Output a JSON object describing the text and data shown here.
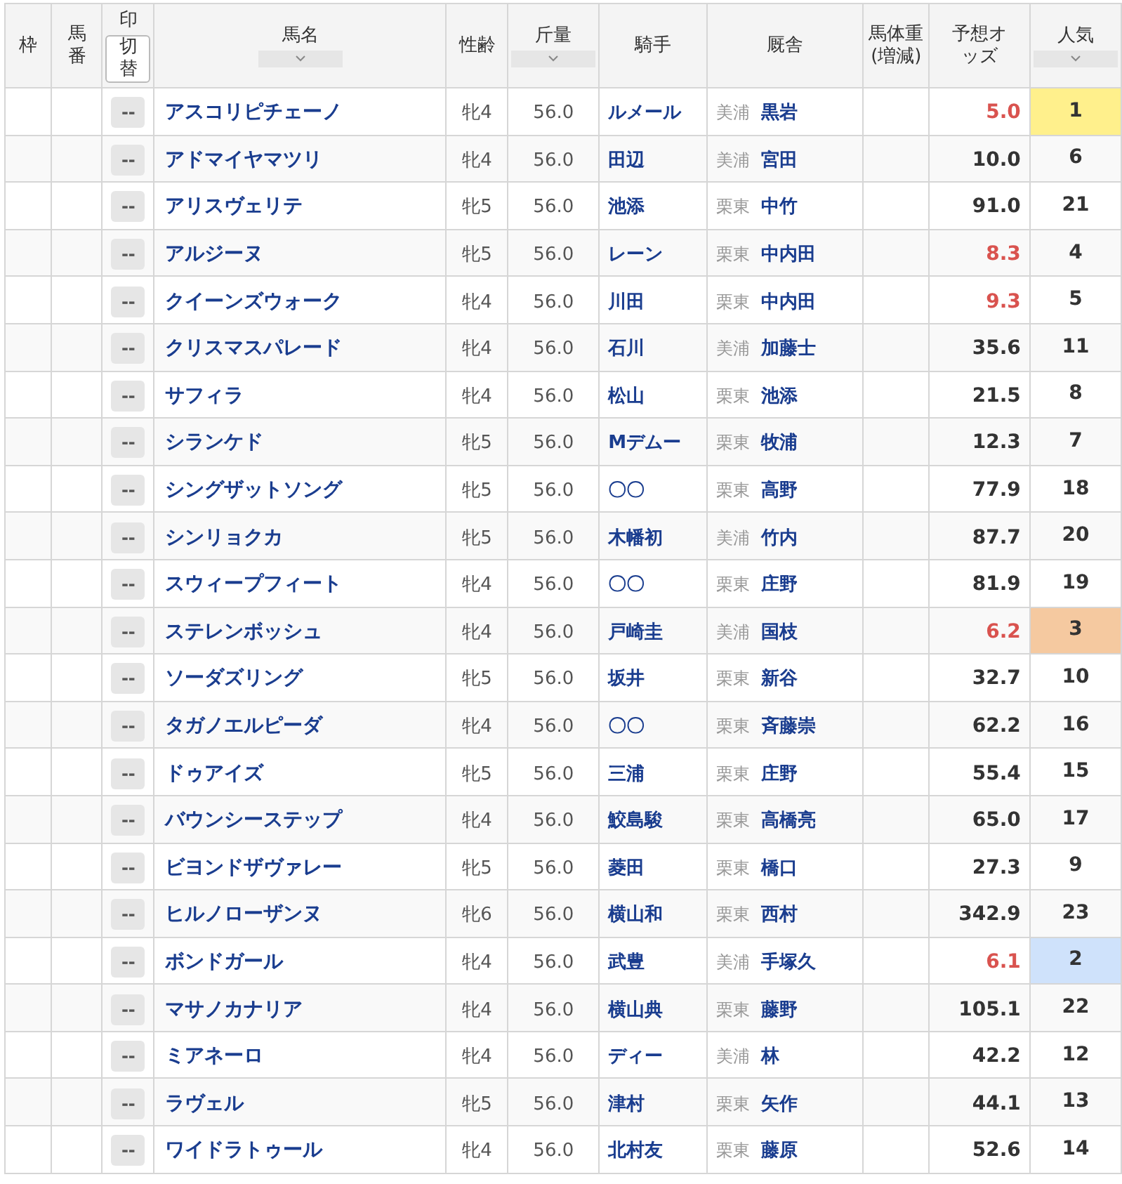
{
  "columns": [
    {
      "label": "枠",
      "sortable": false
    },
    {
      "label": "馬番",
      "sortable": false
    },
    {
      "label": "印",
      "sortable": false,
      "button": "切替"
    },
    {
      "label": "馬名",
      "sortable": true
    },
    {
      "label": "性齢",
      "sortable": false
    },
    {
      "label": "斤量",
      "sortable": true
    },
    {
      "label": "騎手",
      "sortable": false
    },
    {
      "label": "厩舎",
      "sortable": false
    },
    {
      "label": "馬体重(増減)",
      "sortable": false
    },
    {
      "label": "予想オッズ",
      "sortable": false
    },
    {
      "label": "人気",
      "sortable": true
    }
  ],
  "rows": [
    {
      "mark": "--",
      "name": "アスコリピチェーノ",
      "sex_age": "牝4",
      "weight": "56.0",
      "jockey": "ルメール",
      "region": "美浦",
      "trainer": "黒岩",
      "odds": "5.0",
      "odds_hot": true,
      "popularity": "1",
      "color": "#fff08c"
    },
    {
      "mark": "--",
      "name": "アドマイヤマツリ",
      "sex_age": "牝4",
      "weight": "56.0",
      "jockey": "田辺",
      "region": "美浦",
      "trainer": "宮田",
      "odds": "10.0",
      "odds_hot": false,
      "popularity": "6"
    },
    {
      "mark": "--",
      "name": "アリスヴェリテ",
      "sex_age": "牝5",
      "weight": "56.0",
      "jockey": "池添",
      "region": "栗東",
      "trainer": "中竹",
      "odds": "91.0",
      "odds_hot": false,
      "popularity": "21"
    },
    {
      "mark": "--",
      "name": "アルジーヌ",
      "sex_age": "牝5",
      "weight": "56.0",
      "jockey": "レーン",
      "region": "栗東",
      "trainer": "中内田",
      "odds": "8.3",
      "odds_hot": true,
      "popularity": "4"
    },
    {
      "mark": "--",
      "name": "クイーンズウォーク",
      "sex_age": "牝4",
      "weight": "56.0",
      "jockey": "川田",
      "region": "栗東",
      "trainer": "中内田",
      "odds": "9.3",
      "odds_hot": true,
      "popularity": "5"
    },
    {
      "mark": "--",
      "name": "クリスマスパレード",
      "sex_age": "牝4",
      "weight": "56.0",
      "jockey": "石川",
      "region": "美浦",
      "trainer": "加藤士",
      "odds": "35.6",
      "odds_hot": false,
      "popularity": "11"
    },
    {
      "mark": "--",
      "name": "サフィラ",
      "sex_age": "牝4",
      "weight": "56.0",
      "jockey": "松山",
      "region": "栗東",
      "trainer": "池添",
      "odds": "21.5",
      "odds_hot": false,
      "popularity": "8"
    },
    {
      "mark": "--",
      "name": "シランケド",
      "sex_age": "牝5",
      "weight": "56.0",
      "jockey": "Mデムー",
      "region": "栗東",
      "trainer": "牧浦",
      "odds": "12.3",
      "odds_hot": false,
      "popularity": "7"
    },
    {
      "mark": "--",
      "name": "シングザットソング",
      "sex_age": "牝5",
      "weight": "56.0",
      "jockey": "〇〇",
      "region": "栗東",
      "trainer": "高野",
      "odds": "77.9",
      "odds_hot": false,
      "popularity": "18"
    },
    {
      "mark": "--",
      "name": "シンリョクカ",
      "sex_age": "牝5",
      "weight": "56.0",
      "jockey": "木幡初",
      "region": "美浦",
      "trainer": "竹内",
      "odds": "87.7",
      "odds_hot": false,
      "popularity": "20"
    },
    {
      "mark": "--",
      "name": "スウィープフィート",
      "sex_age": "牝4",
      "weight": "56.0",
      "jockey": "〇〇",
      "region": "栗東",
      "trainer": "庄野",
      "odds": "81.9",
      "odds_hot": false,
      "popularity": "19"
    },
    {
      "mark": "--",
      "name": "ステレンボッシュ",
      "sex_age": "牝4",
      "weight": "56.0",
      "jockey": "戸崎圭",
      "region": "美浦",
      "trainer": "国枝",
      "odds": "6.2",
      "odds_hot": true,
      "popularity": "3",
      "color": "#f5c9a0"
    },
    {
      "mark": "--",
      "name": "ソーダズリング",
      "sex_age": "牝5",
      "weight": "56.0",
      "jockey": "坂井",
      "region": "栗東",
      "trainer": "新谷",
      "odds": "32.7",
      "odds_hot": false,
      "popularity": "10"
    },
    {
      "mark": "--",
      "name": "タガノエルピーダ",
      "sex_age": "牝4",
      "weight": "56.0",
      "jockey": "〇〇",
      "region": "栗東",
      "trainer": "斉藤崇",
      "odds": "62.2",
      "odds_hot": false,
      "popularity": "16"
    },
    {
      "mark": "--",
      "name": "ドゥアイズ",
      "sex_age": "牝5",
      "weight": "56.0",
      "jockey": "三浦",
      "region": "栗東",
      "trainer": "庄野",
      "odds": "55.4",
      "odds_hot": false,
      "popularity": "15"
    },
    {
      "mark": "--",
      "name": "バウンシーステップ",
      "sex_age": "牝4",
      "weight": "56.0",
      "jockey": "鮫島駿",
      "region": "栗東",
      "trainer": "高橋亮",
      "odds": "65.0",
      "odds_hot": false,
      "popularity": "17"
    },
    {
      "mark": "--",
      "name": "ビヨンドザヴァレー",
      "sex_age": "牝5",
      "weight": "56.0",
      "jockey": "菱田",
      "region": "栗東",
      "trainer": "橋口",
      "odds": "27.3",
      "odds_hot": false,
      "popularity": "9"
    },
    {
      "mark": "--",
      "name": "ヒルノローザンヌ",
      "sex_age": "牝6",
      "weight": "56.0",
      "jockey": "横山和",
      "region": "栗東",
      "trainer": "西村",
      "odds": "342.9",
      "odds_hot": false,
      "popularity": "23"
    },
    {
      "mark": "--",
      "name": "ボンドガール",
      "sex_age": "牝4",
      "weight": "56.0",
      "jockey": "武豊",
      "region": "美浦",
      "trainer": "手塚久",
      "odds": "6.1",
      "odds_hot": true,
      "popularity": "2",
      "color": "#cfe2fb"
    },
    {
      "mark": "--",
      "name": "マサノカナリア",
      "sex_age": "牝4",
      "weight": "56.0",
      "jockey": "横山典",
      "region": "栗東",
      "trainer": "藤野",
      "odds": "105.1",
      "odds_hot": false,
      "popularity": "22"
    },
    {
      "mark": "--",
      "name": "ミアネーロ",
      "sex_age": "牝4",
      "weight": "56.0",
      "jockey": "ディー",
      "region": "美浦",
      "trainer": "林",
      "odds": "42.2",
      "odds_hot": false,
      "popularity": "12"
    },
    {
      "mark": "--",
      "name": "ラヴェル",
      "sex_age": "牝5",
      "weight": "56.0",
      "jockey": "津村",
      "region": "栗東",
      "trainer": "矢作",
      "odds": "44.1",
      "odds_hot": false,
      "popularity": "13"
    },
    {
      "mark": "--",
      "name": "ワイドラトゥール",
      "sex_age": "牝4",
      "weight": "56.0",
      "jockey": "北村友",
      "region": "栗東",
      "trainer": "藤原",
      "odds": "52.6",
      "odds_hot": false,
      "popularity": "14"
    }
  ]
}
